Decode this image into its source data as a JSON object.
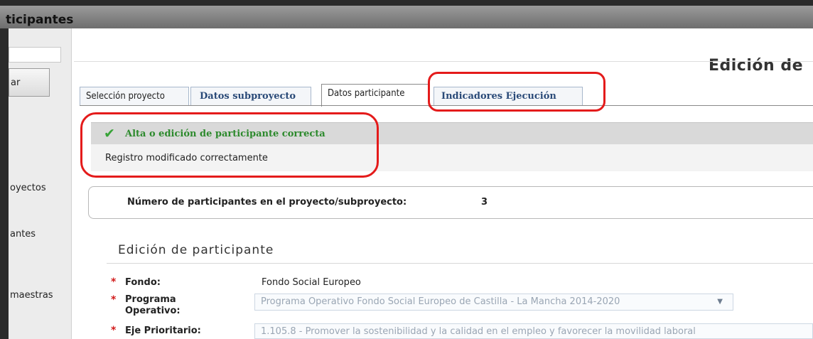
{
  "window": {
    "title": "ticipantes"
  },
  "sidebar": {
    "button_label": "ar",
    "items": [
      "oyectos",
      "antes",
      "maestras"
    ]
  },
  "header": {
    "title": "Edición de"
  },
  "tabs": [
    {
      "label": "Selección proyecto"
    },
    {
      "label": "Datos subproyecto"
    },
    {
      "label": "Datos participante"
    },
    {
      "label": "Indicadores Ejecución"
    }
  ],
  "message": {
    "title": "Alta o edición de participante correcta",
    "body": "Registro modificado correctamente",
    "icon": "check-icon",
    "color": "#2d8a2d"
  },
  "summary": {
    "label": "Número de participantes en el proyecto/subproyecto:",
    "value": "3"
  },
  "form": {
    "title": "Edición de participante",
    "fields": [
      {
        "label": "Fondo:",
        "value": "Fondo Social Europeo"
      },
      {
        "label": "Programa Operativo:",
        "value": "Programa Operativo Fondo Social Europeo de Castilla - La Mancha 2014-2020"
      },
      {
        "label": "Eje Prioritario:",
        "value": "1.105.8 - Promover la sostenibilidad y la calidad en el empleo y favorecer la movilidad laboral"
      }
    ],
    "required_marker": "*"
  },
  "colors": {
    "highlight": "#e41b1b",
    "tab_link": "#2a4a78"
  }
}
